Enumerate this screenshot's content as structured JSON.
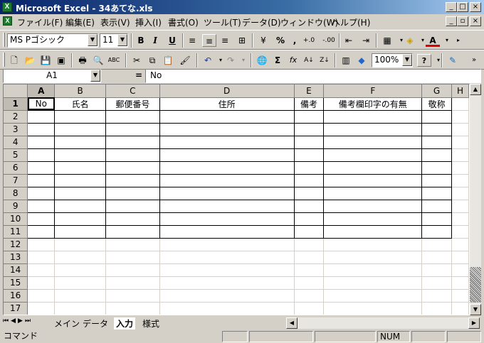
{
  "window": {
    "title": "Microsoft Excel - 34あてな.xls",
    "app_icon": "excel-icon"
  },
  "menu": [
    "ファイル(F)",
    "編集(E)",
    "表示(V)",
    "挿入(I)",
    "書式(O)",
    "ツール(T)",
    "データ(D)",
    "ウィンドウ(W)",
    "ヘルプ(H)"
  ],
  "format_toolbar": {
    "font": "MS Pゴシック",
    "size": "11",
    "bold": "B",
    "italic": "I",
    "underline": "U",
    "percent": "%",
    "comma": ",",
    "dec_inc": "+.0",
    "dec_dec": "-.00",
    "font_color_glyph": "A"
  },
  "std_toolbar": {
    "zoom": "100%",
    "sum": "Σ",
    "fx": "fx",
    "help": "?"
  },
  "formula_bar": {
    "name_box": "A1",
    "equals": "=",
    "content": "No"
  },
  "columns": [
    "A",
    "B",
    "C",
    "D",
    "E",
    "F",
    "G",
    "H"
  ],
  "headers": [
    "No",
    "氏名",
    "郵便番号",
    "住所",
    "備考",
    "備考欄印字の有無",
    "敬称"
  ],
  "rows": [
    "1",
    "2",
    "3",
    "4",
    "5",
    "6",
    "7",
    "8",
    "9",
    "10",
    "11",
    "12",
    "13",
    "14",
    "15",
    "16",
    "17"
  ],
  "sheet_tabs": [
    "メイン",
    "データ",
    "入力",
    "様式"
  ],
  "active_tab": "入力",
  "status": {
    "mode": "コマンド",
    "num": "NUM"
  },
  "colors": {
    "title_start": "#0a246a",
    "title_end": "#a6caf0",
    "excel_green": "#1e7a2e"
  }
}
